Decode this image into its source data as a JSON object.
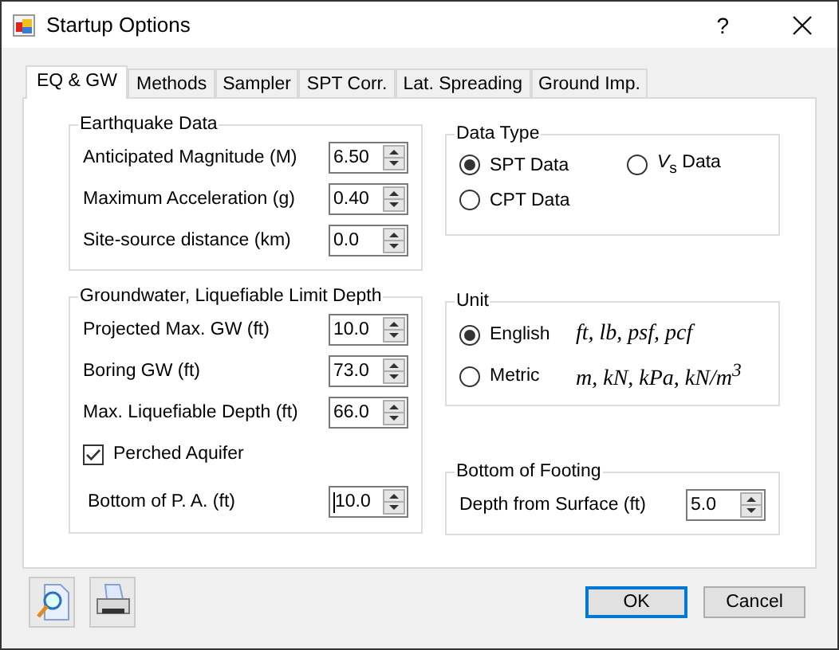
{
  "window": {
    "title": "Startup Options",
    "help": "?"
  },
  "tabs": [
    {
      "label": "EQ & GW",
      "selected": true
    },
    {
      "label": "Methods",
      "selected": false
    },
    {
      "label": "Sampler",
      "selected": false
    },
    {
      "label": "SPT Corr.",
      "selected": false
    },
    {
      "label": "Lat. Spreading",
      "selected": false
    },
    {
      "label": "Ground Imp.",
      "selected": false
    }
  ],
  "earthquake": {
    "title": "Earthquake Data",
    "fields": [
      {
        "label": "Anticipated Magnitude (M)",
        "value": "6.50",
        "focused": false
      },
      {
        "label": "Maximum Acceleration (g)",
        "value": "0.40",
        "focused": false
      },
      {
        "label": "Site-source distance (km)",
        "value": "0.0",
        "focused": false
      }
    ]
  },
  "groundwater": {
    "title": "Groundwater, Liquefiable Limit Depth",
    "fields": [
      {
        "label": "Projected Max. GW (ft)",
        "value": "10.0",
        "focused": false
      },
      {
        "label": "Boring GW (ft)",
        "value": "73.0",
        "focused": false
      },
      {
        "label": "Max. Liquefiable Depth (ft)",
        "value": "66.0",
        "focused": false
      }
    ],
    "perched": {
      "label": "Perched Aquifer",
      "checked": true
    },
    "bottom_pa": {
      "label": "Bottom of P. A. (ft)",
      "value": "10.0",
      "focused": true
    }
  },
  "data_type": {
    "title": "Data Type",
    "options": [
      {
        "label": "SPT Data",
        "selected": true
      },
      {
        "label": "*V*$_{s}$ Data",
        "selected": false
      },
      {
        "label": "CPT Data",
        "selected": false
      }
    ]
  },
  "unit": {
    "title": "Unit",
    "options": [
      {
        "label": "English",
        "units": "ft, lb, psf, pcf",
        "selected": true
      },
      {
        "label": "Metric",
        "units": "m, kN, kPa, kN/m$^{3}$",
        "selected": false
      }
    ]
  },
  "footing": {
    "title": "Bottom of Footing",
    "field": {
      "label": "Depth from Surface (ft)",
      "value": "5.0",
      "focused": false
    }
  },
  "buttons": [
    {
      "label": "OK",
      "default": true
    },
    {
      "label": "Cancel",
      "default": false
    }
  ]
}
